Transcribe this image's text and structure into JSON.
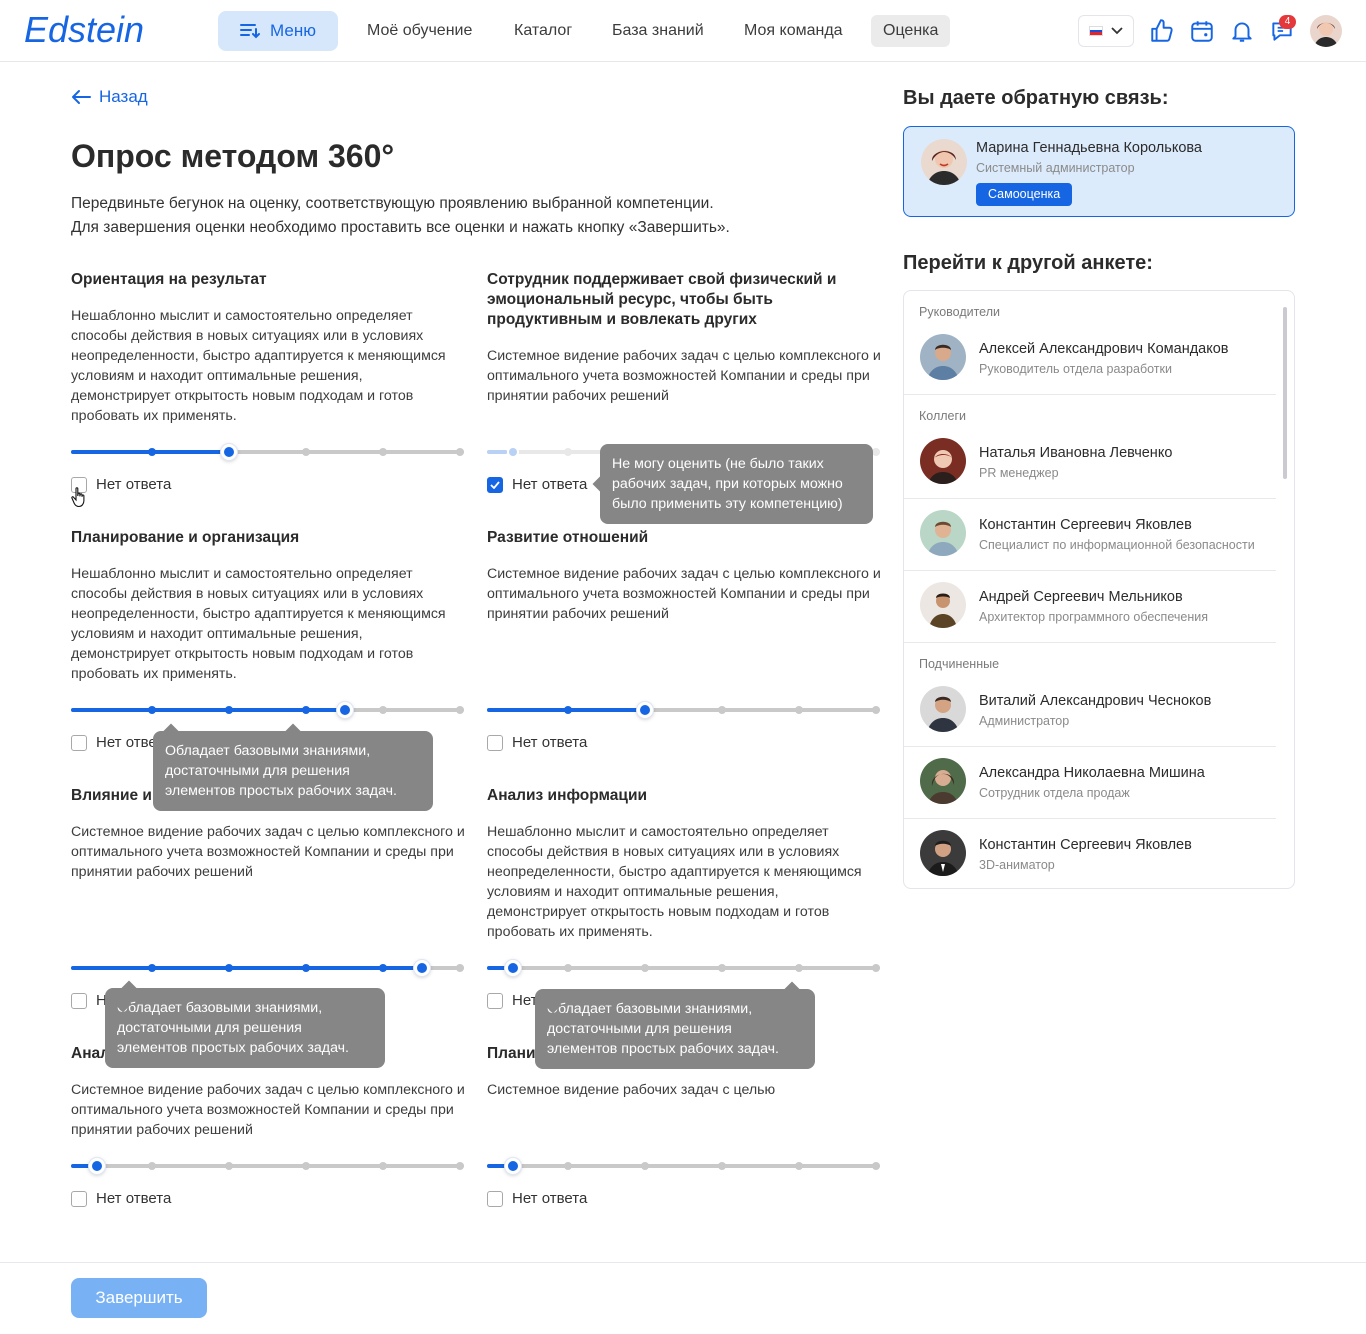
{
  "brand": {
    "logo": "Edstein",
    "accent": "#1666e3"
  },
  "header": {
    "menu_label": "Меню",
    "nav": [
      "Моё обучение",
      "Каталог",
      "База знаний",
      "Моя команда",
      "Оценка"
    ],
    "active_nav": "Оценка",
    "language": "ru",
    "icons": [
      "thumbs-up-icon",
      "calendar-icon",
      "bell-icon",
      "chat-icon"
    ],
    "chat_badge": "4"
  },
  "back_label": "Назад",
  "page_title": "Опрос методом 360°",
  "intro": [
    "Передвиньте бегунок на оценку, соответствующую проявлению выбранной компетенции.",
    "Для завершения оценки необходимо проставить все оценки и нажать кнопку «Завершить»."
  ],
  "no_answer_label": "Нет ответа",
  "competencies": [
    {
      "title": "Ориентация на результат",
      "description": "Нешаблонно мыслит и самостоятельно определяет способы действия в новых ситуациях или в условиях неопределенности, быстро адаптируется к меняющимся условиям и находит оптимальные решения, демонстрирует открытость новым подходам и готов пробовать их применять.",
      "rating": 2,
      "of": 5,
      "no_answer": false
    },
    {
      "title": "Сотрудник поддерживает свой физический и эмоциональный ресурс, чтобы быть продуктивным и вовлекать других",
      "description": "Системное видение рабочих задач с целью комплексного и оптимального учета возможностей Компании и среды при принятии рабочих решений",
      "rating": 0,
      "of": 5,
      "no_answer": true
    },
    {
      "title": "Планирование и организация",
      "description": "Нешаблонно мыслит и самостоятельно определяет способы действия в новых ситуациях или в условиях неопределенности, быстро адаптируется к меняющимся условиям и находит оптимальные решения, демонстрирует открытость новым подходам и готов пробовать их применять.",
      "rating": 3.5,
      "of": 5,
      "no_answer": false
    },
    {
      "title": "Развитие отношений",
      "description": "Системное видение рабочих задач с целью комплексного и оптимального учета возможностей Компании и среды при принятии рабочих решений",
      "rating": 2,
      "of": 5,
      "no_answer": false
    },
    {
      "title": "Влияние и",
      "description": "Системное видение рабочих задач с целью комплексного и оптимального учета возможностей Компании и среды при принятии рабочих решений",
      "rating": 4.5,
      "of": 5,
      "no_answer": false
    },
    {
      "title": "Анализ информации",
      "description": "Нешаблонно мыслит и самостоятельно определяет способы действия в новых ситуациях или в условиях неопределенности, быстро адаптируется к меняющимся условиям и находит оптимальные решения, демонстрирует открытость новым подходам и готов пробовать их применять.",
      "rating": 0,
      "of": 5,
      "no_answer": false
    },
    {
      "title": "Анал",
      "description": "Системное видение рабочих задач с целью комплексного и оптимального учета возможностей Компании и среды при принятии рабочих решений",
      "rating": 0,
      "of": 5,
      "no_answer": false
    },
    {
      "title": "Плани",
      "description": "Системное видение рабочих задач с целью",
      "rating": 0,
      "of": 5,
      "no_answer": false
    }
  ],
  "tooltips": {
    "cannot_rate": "Не могу оценить (не было таких рабочих задач, при которых можно было применить эту компетенцию)",
    "basic": "Обладает базовыми знаниями, достаточными для решения элементов простых рабочих задач."
  },
  "feedback": {
    "title": "Вы даете обратную связь:",
    "name": "Марина Геннадьевна Королькова",
    "role": "Системный администратор",
    "button": "Самооценка"
  },
  "other": {
    "title": "Перейти к другой анкете:",
    "groups": [
      {
        "label": "Руководители",
        "people": [
          {
            "name": "Алексей Александрович Командаков",
            "role": "Руководитель отдела разработки"
          }
        ]
      },
      {
        "label": "Коллеги",
        "people": [
          {
            "name": "Наталья Ивановна Левченко",
            "role": "PR менеджер"
          },
          {
            "name": "Константин Сергеевич Яковлев",
            "role": "Специалист по информационной безопасности"
          },
          {
            "name": "Андрей Сергеевич Мельников",
            "role": "Архитектор программного обеспечения"
          }
        ]
      },
      {
        "label": "Подчиненные",
        "people": [
          {
            "name": "Виталий Александрович Чесноков",
            "role": "Администратор"
          },
          {
            "name": "Александра Николаевна Мишина",
            "role": "Сотрудник отдела продаж"
          },
          {
            "name": "Константин Сергеевич Яковлев",
            "role": "3D-аниматор"
          }
        ]
      }
    ]
  },
  "finish_label": "Завершить"
}
